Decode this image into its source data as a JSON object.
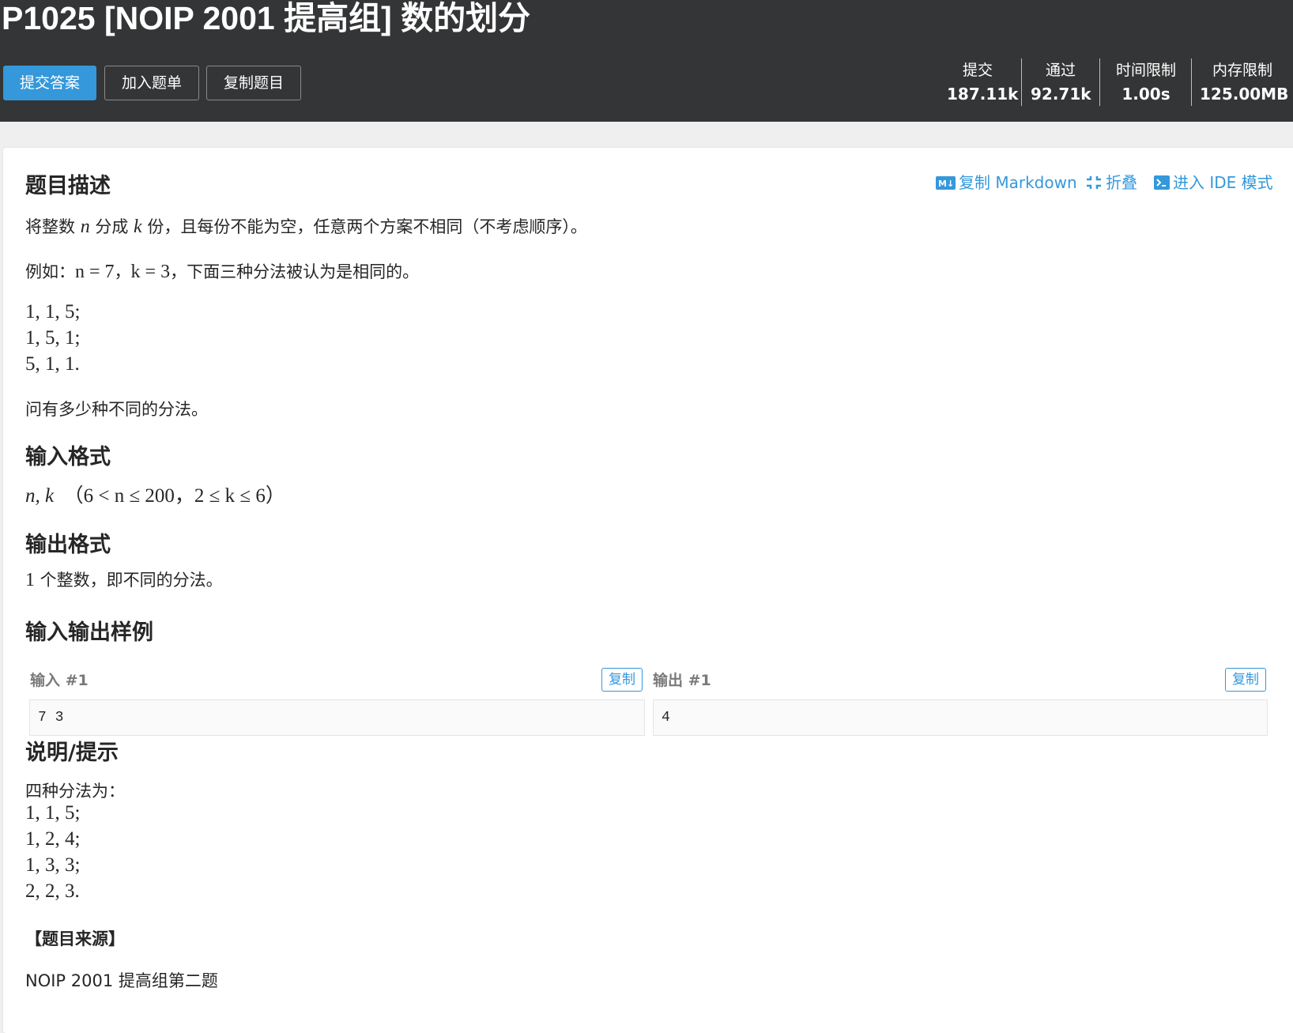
{
  "header": {
    "title": "P1025 [NOIP 2001 提高组] 数的划分",
    "buttons": {
      "submit": "提交答案",
      "add_to_list": "加入题单",
      "copy_problem": "复制题目"
    },
    "stats": [
      {
        "label": "提交",
        "value": "187.11k"
      },
      {
        "label": "通过",
        "value": "92.71k"
      },
      {
        "label": "时间限制",
        "value": "1.00s"
      },
      {
        "label": "内存限制",
        "value": "125.00MB"
      }
    ]
  },
  "toolbar": {
    "copy_markdown": "复制 Markdown",
    "fold": "折叠",
    "ide_mode": "进入 IDE 模式"
  },
  "description": {
    "heading": "题目描述",
    "line1": {
      "a": "将整数 ",
      "n": "n",
      "b": " 分成 ",
      "k": "k",
      "c": " 份，且每份不能为空，任意两个方案不相同（不考虑顺序）。"
    },
    "line2": {
      "a": "例如：",
      "eq1": "n = 7",
      "sep": "，",
      "eq2": "k = 3",
      "b": "，下面三种分法被认为是相同的。"
    },
    "examples": [
      "1, 1, 5;",
      "1, 5, 1;",
      "5, 1, 1."
    ],
    "question": "问有多少种不同的分法。"
  },
  "input_format": {
    "heading": "输入格式",
    "vars": "n, k",
    "constraint": "（6 < n ≤ 200，2 ≤ k ≤ 6）"
  },
  "output_format": {
    "heading": "输出格式",
    "num": "1",
    "text": " 个整数，即不同的分法。"
  },
  "samples": {
    "heading": "输入输出样例",
    "input_label": "输入 #1",
    "output_label": "输出 #1",
    "copy_label": "复制",
    "input_value": "7 3",
    "output_value": "4"
  },
  "hint": {
    "heading": "说明/提示",
    "intro": "四种分法为：",
    "ways": [
      "1, 1, 5;",
      "1, 2, 4;",
      "1, 3, 3;",
      "2, 2, 3."
    ],
    "source_heading": "【题目来源】",
    "source": "NOIP 2001 提高组第二题"
  },
  "colors": {
    "accent": "#3498db",
    "header_bg": "#343536"
  },
  "icons": [
    "markdown-icon",
    "collapse-icon",
    "terminal-icon"
  ]
}
